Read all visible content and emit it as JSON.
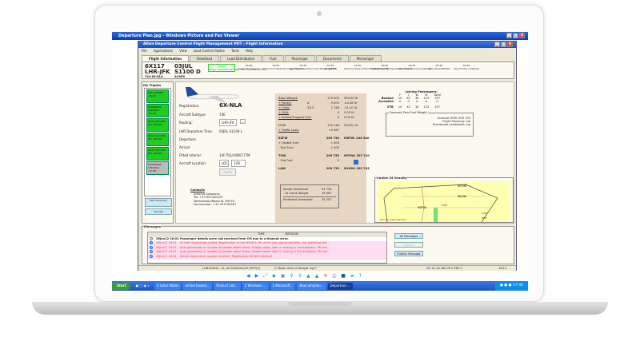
{
  "viewer": {
    "title": "Departure Plan.jpg - Windows Picture and Fax Viewer"
  },
  "app": {
    "title": "Altéa Departure Control Flight Management PDT - Flight Information",
    "menu": [
      "File",
      "Applications",
      "View",
      "Load Control Status",
      "Tools",
      "Help"
    ],
    "tabs": [
      "Flight Information",
      "Deadload",
      "Load Distribution",
      "Fuel",
      "Passenger",
      "Documents",
      "Messenger"
    ]
  },
  "flight": {
    "number": "6X117",
    "route": "LHR-JFK",
    "aircraft": "744 6X-NLA",
    "date": "03JUL",
    "std": "S1100 D",
    "acars": "ACARS"
  },
  "milestones": [
    {
      "time": "04:20",
      "label": "Status 'Commercial Flight Plan' Received (CFPL)"
    },
    {
      "time": "04:00",
      "label": "Compute Capacity"
    },
    {
      "time": "03:00",
      "label": "Check for Deadload Cargo Figures"
    },
    {
      "time": "02:30",
      "label": "Send Forecast Zero Fuel Weight (FZFW)"
    },
    {
      "time": "01:20",
      "label": "Assigned"
    },
    {
      "time": "01:00",
      "label": "Send Loading Instruction/Report (LIR)"
    },
    {
      "time": "00:50",
      "label": "Send Final Fuel Figures Document"
    },
    {
      "time": "00:40",
      "label": "Send Provisional Loadsheet"
    },
    {
      "time": "00:44",
      "label": "Send Final NOTOC"
    },
    {
      "time": "00:10",
      "label": "Send Final Loadsheet"
    }
  ],
  "my_flights": {
    "title": "My Flights",
    "items": [
      {
        "text": "6X5 LHR-MIT -39:02",
        "status": "green"
      },
      {
        "text": "6X5680/29 LHR-MUC -01:48",
        "status": "green"
      },
      {
        "text": "6X117/03 LHR-JFK -102:40",
        "status": "green"
      },
      {
        "text": "6X117/04 LHR-JFK -158:40",
        "status": "green"
      },
      {
        "text": "6X117/05 LHR-JFK -218:00",
        "status": "green"
      },
      {
        "text": "6X5680/28 LHR-MUC -37:48",
        "status": "grey"
      }
    ],
    "shift_summary": "Shift Summary",
    "allocate": "Allocate"
  },
  "aircraft": {
    "registration_label": "Registration:",
    "registration": "6X-NLA",
    "subtype_label": "Aircraft Subtype:",
    "subtype": "74E",
    "routing_label": "Routing:",
    "routing": "LHR-JFK",
    "departure_time_label": "LHR Departure Time:",
    "departure_time": "03JUL S1100 L",
    "departure_label": "Departure:",
    "arrival_label": "Arrival:",
    "interior_label": "Fitted Interior:",
    "interior": "14F/7(J)/30W/177M",
    "location_label": "Aircraft Location:",
    "location_type": "LOC",
    "location": "12B",
    "apply": "Apply"
  },
  "contacts": {
    "title": "Contacts",
    "name": "Antonia Cokanova",
    "tel": "Tel: +33 497230202",
    "workstation": "Workstation/Radio Id: 83253",
    "fax": "Fax Number: +33 497230567"
  },
  "weights": [
    {
      "label": "Basic Weight:",
      "code": "",
      "value": "179 400",
      "index": "590.00 IU",
      "style": "u"
    },
    {
      "label": "+ Pantry:",
      "code": "A",
      "value": "9 000",
      "index": "-44.38 IU",
      "style": "u"
    },
    {
      "label": "+ Crew:",
      "code": "3/15",
      "value": "1 746",
      "index": "-11.10 IU",
      "style": "u"
    },
    {
      "label": "+ DHA:",
      "code": "",
      "value": "0",
      "index": "0.00 IU",
      "style": "u"
    },
    {
      "label": "+ Ballast/Trapped Fuel:",
      "code": "",
      "value": "0",
      "index": "0.00 IU",
      "style": "u"
    },
    {
      "label": "DOW",
      "code": "",
      "value": "190 146",
      "index": "534.52 IU",
      "style": ""
    },
    {
      "label": "+ Traffic Load:",
      "code": "",
      "value": "19 587",
      "index": "",
      "style": "u"
    },
    {
      "label": "EZFW",
      "code": "",
      "value": "209 733",
      "index": "MZFW: 244 940",
      "style": "b"
    },
    {
      "label": "+ Usable Fuel:",
      "code": "",
      "value": "1 500",
      "index": "",
      "style": ""
    },
    {
      "label": "- Taxi Fuel:",
      "code": "",
      "value": "1 500",
      "index": "",
      "style": ""
    },
    {
      "label": "TOW",
      "code": "",
      "value": "209 733",
      "index": "MTOW: 397 210",
      "style": "b"
    },
    {
      "label": "- Trip Fuel:",
      "code": "",
      "value": "0",
      "index": "",
      "style": ""
    },
    {
      "label": "LAW",
      "code": "",
      "value": "209 733",
      "index": "MLDW: 295 743",
      "style": "b"
    }
  ],
  "underload": {
    "actual_label": "Actual Underload",
    "actual": "54 794",
    "tocome_label": "- To Come Weight",
    "tocome": "19 587",
    "predicted_label": "Predicted Underload",
    "predicted": "35 207"
  },
  "joining": {
    "title": "Joining Passengers:",
    "columns": [
      "F",
      "J",
      "W",
      "M",
      "Total"
    ],
    "rows": [
      {
        "label": "Booked",
        "values": [
          "10",
          "42",
          "30",
          "115",
          "197"
        ]
      },
      {
        "label": "Accepted",
        "values": [
          "0",
          "0",
          "0",
          "0",
          "0"
        ]
      },
      {
        "label": "ETB",
        "values": [
          "10",
          "42",
          "30",
          "115",
          "197"
        ]
      }
    ]
  },
  "fzfw": {
    "title": "Forecast Zero Fuel Weight",
    "forecast": "Forecast ZFW: 209 733",
    "planning": "Flight Planning: n/a",
    "provisional": "Provisional Loadsheet: n/a"
  },
  "cog": {
    "title": "Centre Of Gravity",
    "labels": [
      "MTOW",
      "MLDW",
      "MZFW",
      "TOW",
      "LAW",
      "ZFW"
    ],
    "trim": "Trim by Cabin Section"
  },
  "messages": {
    "title": "Messages",
    "columns": [
      "TIME",
      "MESSAGE"
    ],
    "rows": [
      {
        "time": "26Jun12 16:02",
        "text": "Passenger details were not received from CM due to a timeout error.",
        "checked": false,
        "red": false
      },
      {
        "time": "26Jun12 16:01",
        "text": "Aircraft registration added. Registration is now 6X-NLA. Re-check your documentation, dry operating wei...",
        "checked": true,
        "red": true
      },
      {
        "time": "26Jun12 16:01",
        "text": "Auto generation or update of potable water failed. Potable water data is missing in the database. FM can...",
        "checked": true,
        "red": true
      },
      {
        "time": "26Jun12 16:01",
        "text": "Auto generation or update of potable water failed. Potable water data is missing in the database. FM can...",
        "checked": true,
        "red": true
      },
      {
        "time": "26Jun12 16:01",
        "text": "Invalid registration update received. Registration 6X-NLB rejected.",
        "checked": true,
        "red": true
      }
    ],
    "all": "All Messages",
    "expand": "Expand",
    "publish": "Publish Message"
  },
  "status": {
    "left": "LON1A0955, 1A, ACO0A0G0A/G5 (PDT/U)",
    "mid": "CI Down  Units of Weight: Kg  P",
    "right": "GO  LO  AO  BN  LIR 0  PRV 0",
    "time": "16:12"
  },
  "taskbar": {
    "start": "Start",
    "items": [
      "4 Lotus Notes",
      "airline bookin...",
      "Product Libr...",
      "2 Windows ...",
      "2 Microsoft...",
      "New amadeu...",
      "Departure ..."
    ],
    "clock": "17:40"
  },
  "colors": {
    "flight_ok": "#1fcc1f",
    "alert": "#e33333",
    "titlebar": "#1a4fc0"
  }
}
